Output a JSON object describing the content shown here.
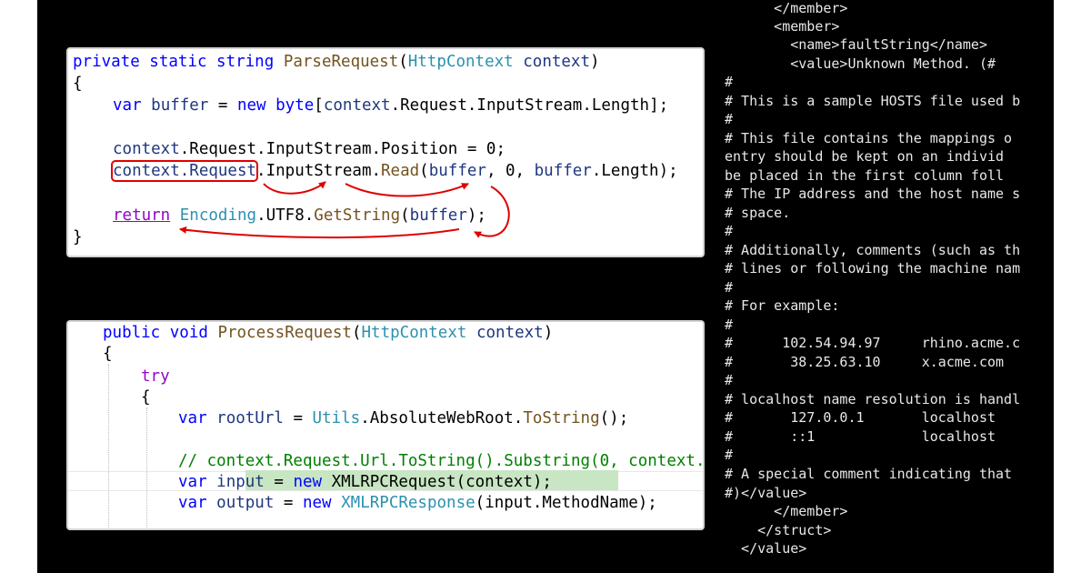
{
  "snippet1": {
    "sig_kw": "private static string",
    "sig_fn": "ParseRequest",
    "sig_paren": "(",
    "sig_type": "HttpContext",
    "sig_param": "context",
    "sig_close": ")",
    "open_brace": "{",
    "l3_var": "var",
    "l3_buffer": "buffer",
    "l3_eq": " = ",
    "l3_new": "new",
    "l3_byte": "byte",
    "l3_bracket": "[",
    "l3_ctx": "context",
    "l3_rest": ".Request.InputStream.Length];",
    "l5_ctx": "context",
    "l5_rest": ".Request.InputStream.Position = 0;",
    "l6_boxed": "context.Request",
    "l6_a": ".InputStream.",
    "l6_read": "Read",
    "l6_paren": "(",
    "l6_buffer": "buffer",
    "l6_mid": ", 0, ",
    "l6_buffer2": "buffer",
    "l6_end": ".Length);",
    "l8_return": "return",
    "l8_enc": "Encoding",
    "l8_dot": ".UTF8.",
    "l8_get": "GetString",
    "l8_paren": "(",
    "l8_buffer": "buffer",
    "l8_end": ");",
    "close_brace": "}"
  },
  "snippet2": {
    "sig_kw": "public void",
    "sig_fn": "ProcessRequest",
    "sig_paren": "(",
    "sig_type": "HttpContext",
    "sig_param": "context",
    "sig_close": ")",
    "brace1": "{",
    "try_kw": "try",
    "brace2": "{",
    "l5_var": "var",
    "l5_root": "rootUrl",
    "l5_eq": " = ",
    "l5_utils": "Utils",
    "l5_dot": ".AbsoluteWebRoot.",
    "l5_tostr": "ToString",
    "l5_end": "();",
    "comment": "// context.Request.Url.ToString().Substring(0, context.",
    "l8_var": "var",
    "l8_input": "input",
    "l8_eq": " = ",
    "l8_new": "new",
    "l8_type": "XMLRPCRequest",
    "l8_args": "(context);",
    "l9_var": "var",
    "l9_output": "output",
    "l9_eq": " = ",
    "l9_new": "new",
    "l9_type": "XMLRPCResponse",
    "l9_args": "(input.MethodName);"
  },
  "terminal": {
    "lines": [
      "      </member>",
      "      <member>",
      "        <name>faultString</name>",
      "        <value>Unknown Method. (#",
      "#",
      "# This is a sample HOSTS file used b",
      "#",
      "# This file contains the mappings o",
      "entry should be kept on an individ",
      "be placed in the first column foll",
      "# The IP address and the host name s",
      "# space.",
      "#",
      "# Additionally, comments (such as th",
      "# lines or following the machine nam",
      "#",
      "# For example:",
      "#",
      "#      102.54.94.97     rhino.acme.c",
      "#       38.25.63.10     x.acme.com",
      "#",
      "# localhost name resolution is handl",
      "#       127.0.0.1       localhost",
      "#       ::1             localhost",
      "#",
      "# A special comment indicating that",
      "#)</value>",
      "      </member>",
      "    </struct>",
      "  </value>"
    ]
  },
  "colors": {
    "keyword": "#0000ff",
    "type": "#2b91af",
    "identifier": "#1f377f",
    "method": "#74531f",
    "control": "#8f08c4",
    "comment": "#008000",
    "annotation": "#e00000",
    "highlight": "#c8e6c3",
    "terminal_bg": "#000000",
    "terminal_fg": "#e8e8e8"
  }
}
